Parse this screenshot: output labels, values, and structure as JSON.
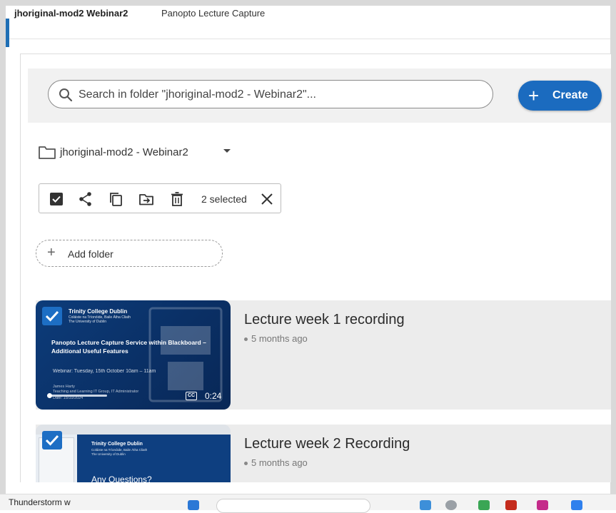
{
  "header": {
    "course_title": "jhoriginal-mod2 Webinar2",
    "tool_title": "Panopto Lecture Capture"
  },
  "search": {
    "placeholder": "Search in folder \"jhoriginal-mod2 - Webinar2\"...",
    "icon": "search-icon"
  },
  "create_button": {
    "label": "Create",
    "icon": "plus-icon"
  },
  "folder": {
    "name": "jhoriginal-mod2 - Webinar2",
    "icon": "folder-icon"
  },
  "selection_toolbar": {
    "selected_text": "2 selected",
    "icons": [
      "checkbox-checked-icon",
      "share-icon",
      "copy-icon",
      "move-icon",
      "delete-icon",
      "close-icon"
    ]
  },
  "add_folder": {
    "label": "Add folder"
  },
  "sessions": [
    {
      "title": "Lecture week 1 recording",
      "date": "5 months ago",
      "duration": "0:24",
      "cc": "CC",
      "thumbnail": {
        "brand": "Trinity College Dublin",
        "brand_sub1": "Coláiste na Tríonóide, Baile Átha Cliath",
        "brand_sub2": "The University of Dublin",
        "line1": "Panopto Lecture Capture Service within Blackboard –",
        "line2": "Additional Useful Features",
        "webinar_line": "Webinar: Tuesday, 15th October 10am – 11am",
        "presenter": "James Harty",
        "presenter_role": "Teaching and Learning IT Group, IT Administrator",
        "date_line": "Date: 15/10/2024"
      },
      "progress": 0.0
    },
    {
      "title": "Lecture week 2 Recording",
      "date": "5 months ago",
      "thumbnail": {
        "brand": "Trinity College Dublin",
        "brand_sub1": "Coláiste na Tríonóide, Baile Átha Cliath",
        "brand_sub2": "The University of Dublin",
        "slide_text": "Any Questions?"
      }
    }
  ],
  "taskbar": {
    "weather": "Thunderstorm w"
  },
  "colors": {
    "accent": "#1b6bbf",
    "row_bg": "#ececec",
    "thumb_navy": "#0d3c7a"
  }
}
